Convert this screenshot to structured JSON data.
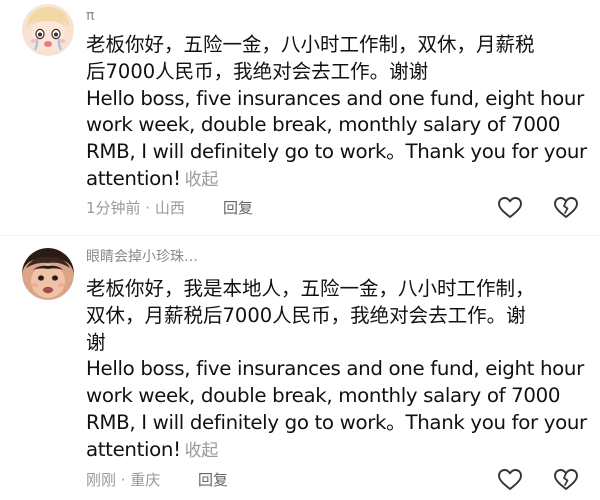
{
  "comments": [
    {
      "username": "π",
      "avatar": "cartoon-girl-avatar",
      "text_lines": [
        "老板你好，五险一金，八小时工作制，双休，月薪税",
        "后7000人民币，我绝对会去工作。谢谢",
        "Hello boss, five insurances and one fund, eight hour",
        "work week, double break, monthly salary of 7000",
        "RMB, I will definitely go to work。Thank you for your",
        "attention!"
      ],
      "collapse_label": "收起",
      "time_location": "1分钟前 · 山西",
      "reply_label": "回复",
      "like_icon": "heart-outline-icon",
      "dislike_icon": "broken-heart-icon"
    },
    {
      "username": "眼睛会掉小珍珠…",
      "avatar": "crying-child-avatar",
      "text_lines": [
        "老板你好，我是本地人，五险一金，八小时工作制，",
        "双休，月薪税后7000人民币，我绝对会去工作。谢",
        "谢",
        "Hello boss, five insurances and one fund, eight hour",
        "work week, double break, monthly salary of 7000",
        "RMB, I will definitely go to work。Thank you for your",
        "attention!"
      ],
      "collapse_label": "收起",
      "time_location": "刚刚 · 重庆",
      "reply_label": "回复",
      "like_icon": "heart-outline-icon",
      "dislike_icon": "broken-heart-icon"
    }
  ],
  "colors": {
    "text_primary": "#111111",
    "text_secondary": "#9a9a9a",
    "reply": "#666666",
    "icon_stroke": "#333333"
  }
}
